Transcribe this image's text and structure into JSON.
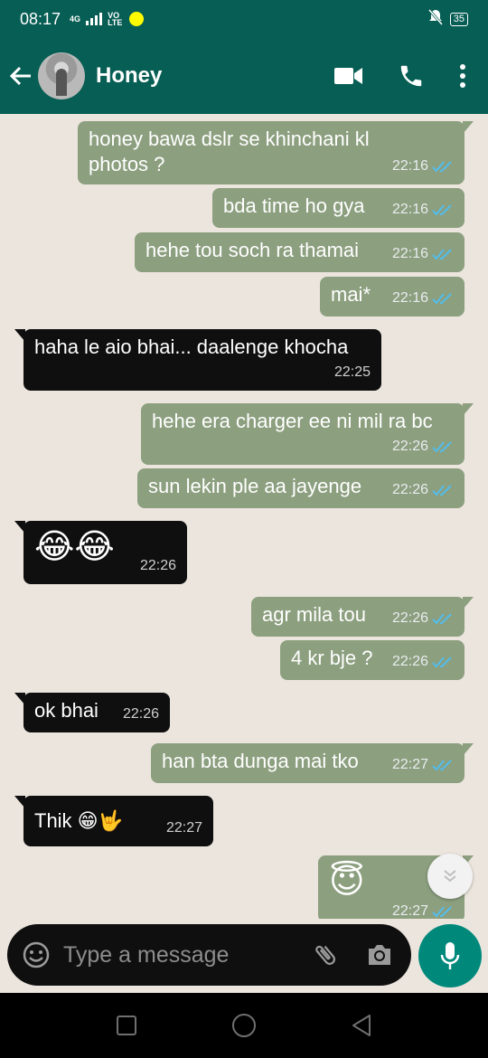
{
  "status_bar": {
    "time": "08:17",
    "network": "4G",
    "volte_top": "VO",
    "volte_bottom": "LTE",
    "battery": "35"
  },
  "header": {
    "contact_name": "Honey",
    "icons": [
      "back-arrow-icon",
      "video-call-icon",
      "phone-icon",
      "more-vert-icon"
    ]
  },
  "messages": [
    {
      "dir": "out",
      "text": "honey bawa dslr se khinchani kl photos ?",
      "time": "22:16",
      "ticks": "read"
    },
    {
      "dir": "out",
      "text": "bda time ho gya",
      "time": "22:16",
      "ticks": "read"
    },
    {
      "dir": "out",
      "text": "hehe tou soch ra thamai",
      "time": "22:16",
      "ticks": "read"
    },
    {
      "dir": "out",
      "text": "mai*",
      "time": "22:16",
      "ticks": "read"
    },
    {
      "dir": "in",
      "text": "haha le aio bhai... daalenge khocha",
      "time": "22:25"
    },
    {
      "dir": "out",
      "text": "hehe era charger ee ni mil ra bc",
      "time": "22:26",
      "ticks": "read"
    },
    {
      "dir": "out",
      "text": "sun lekin ple aa jayenge",
      "time": "22:26",
      "ticks": "read"
    },
    {
      "dir": "in",
      "text": "😂😂",
      "time": "22:26"
    },
    {
      "dir": "out",
      "text": "agr mila tou",
      "time": "22:26",
      "ticks": "read"
    },
    {
      "dir": "out",
      "text": "4 kr bje ?",
      "time": "22:26",
      "ticks": "read"
    },
    {
      "dir": "in",
      "text": "ok bhai",
      "time": "22:26"
    },
    {
      "dir": "out",
      "text": "han bta dunga mai tko",
      "time": "22:27",
      "ticks": "read"
    },
    {
      "dir": "in",
      "text": "Thik 😁🤟",
      "time": "22:27"
    },
    {
      "dir": "out",
      "text": "😇",
      "time": "22:27",
      "ticks": "read"
    }
  ],
  "composer": {
    "placeholder": "Type a message",
    "icons": [
      "emoji-icon",
      "attach-icon",
      "camera-icon",
      "mic-icon"
    ]
  },
  "colors": {
    "header": "#075e54",
    "outgoing_bubble": "#8c9f7f",
    "incoming_bubble": "#0f0f0f",
    "read_ticks": "#53bdeb",
    "mic_button": "#00897b"
  }
}
